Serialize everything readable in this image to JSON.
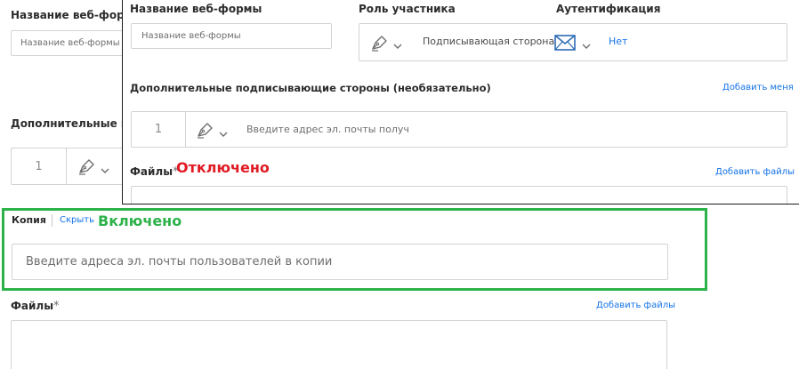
{
  "background": {
    "webform_name_label": "Название веб-формы",
    "webform_name_placeholder": "Название веб-формы",
    "additional_signers_label": "Дополнительные подп",
    "signer_index": "1",
    "copy_label": "Копия",
    "hide_link": "Скрыть",
    "cc_placeholder": "Введите адреса эл. почты пользователей в копии",
    "files_label": "Файлы",
    "files_required_mark": "*",
    "add_files_link": "Добавить файлы"
  },
  "overlay": {
    "webform_name_label": "Название веб-формы",
    "webform_name_placeholder": "Название веб-формы",
    "role_label": "Роль участника",
    "role_value": "Подписывающая сторона",
    "auth_label": "Аутентификация",
    "auth_value": "Нет",
    "additional_signers_label": "Дополнительные подписывающие стороны (необязательно)",
    "add_me_link": "Добавить меня",
    "signer_index": "1",
    "signer_email_placeholder": "Введите адрес эл. почты получ",
    "files_label": "Файлы",
    "files_required_mark": "*",
    "add_files_link": "Добавить файлы"
  },
  "annotations": {
    "disabled": "Отключено",
    "enabled": "Включено"
  },
  "icons": {
    "role": "pen-signer-icon",
    "auth": "email-envelope-icon",
    "dropdown": "chevron-down-icon"
  },
  "colors": {
    "accent_link": "#1473e6",
    "annotation_disabled": "#e01b24",
    "annotation_enabled": "#2db24a",
    "envelope": "#2d6bb5"
  }
}
